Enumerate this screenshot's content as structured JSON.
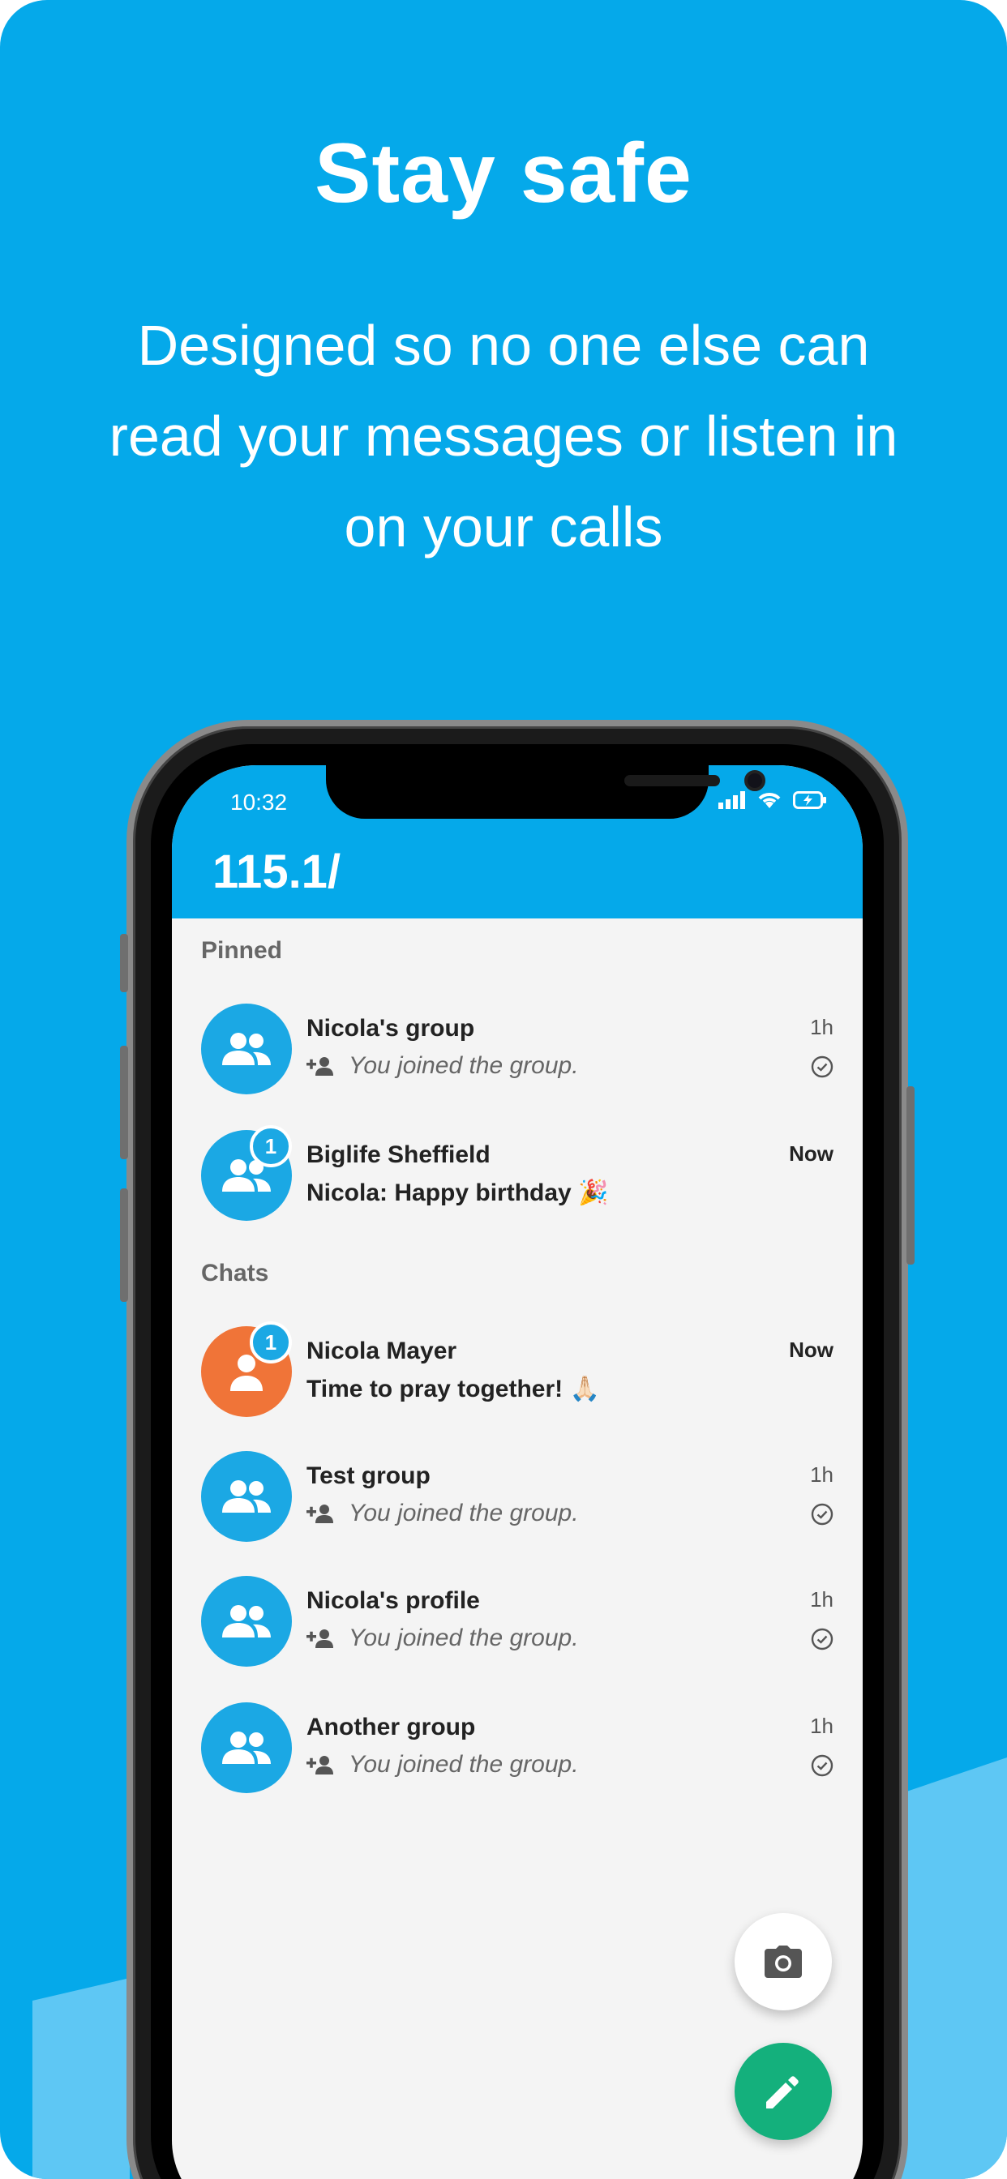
{
  "headline": "Stay safe",
  "subline": "Designed so no one else can read your messages or listen in on your calls",
  "colors": {
    "brand_blue": "#05a9ea",
    "avatar_blue": "#1ba8e4",
    "avatar_orange": "#f07438",
    "fab_green": "#14b07c"
  },
  "status_bar": {
    "time": "10:32",
    "icons": [
      "signal-icon",
      "wifi-icon",
      "battery-icon"
    ]
  },
  "app": {
    "title": "115.1/"
  },
  "sections": {
    "pinned": "Pinned",
    "chats": "Chats"
  },
  "pinned": [
    {
      "name": "Nicola's group",
      "time": "1h",
      "message": "You joined the group.",
      "type": "system",
      "unread": null,
      "avatar": "group-icon"
    },
    {
      "name": "Biglife Sheffield",
      "time": "Now",
      "message": "Nicola: Happy birthday 🎉",
      "type": "message",
      "unread": "1",
      "avatar": "group-icon"
    }
  ],
  "chats": [
    {
      "name": "Nicola Mayer",
      "time": "Now",
      "message": "Time to pray together! 🙏🏻",
      "type": "message",
      "unread": "1",
      "avatar": "person-icon"
    },
    {
      "name": "Test group",
      "time": "1h",
      "message": "You joined the group.",
      "type": "system",
      "unread": null,
      "avatar": "group-icon"
    },
    {
      "name": "Nicola's profile",
      "time": "1h",
      "message": "You joined the group.",
      "type": "system",
      "unread": null,
      "avatar": "group-icon"
    },
    {
      "name": "Another group",
      "time": "1h",
      "message": "You joined the group.",
      "type": "system",
      "unread": null,
      "avatar": "group-icon"
    }
  ],
  "fabs": {
    "camera": "camera-icon",
    "compose": "pencil-icon"
  }
}
